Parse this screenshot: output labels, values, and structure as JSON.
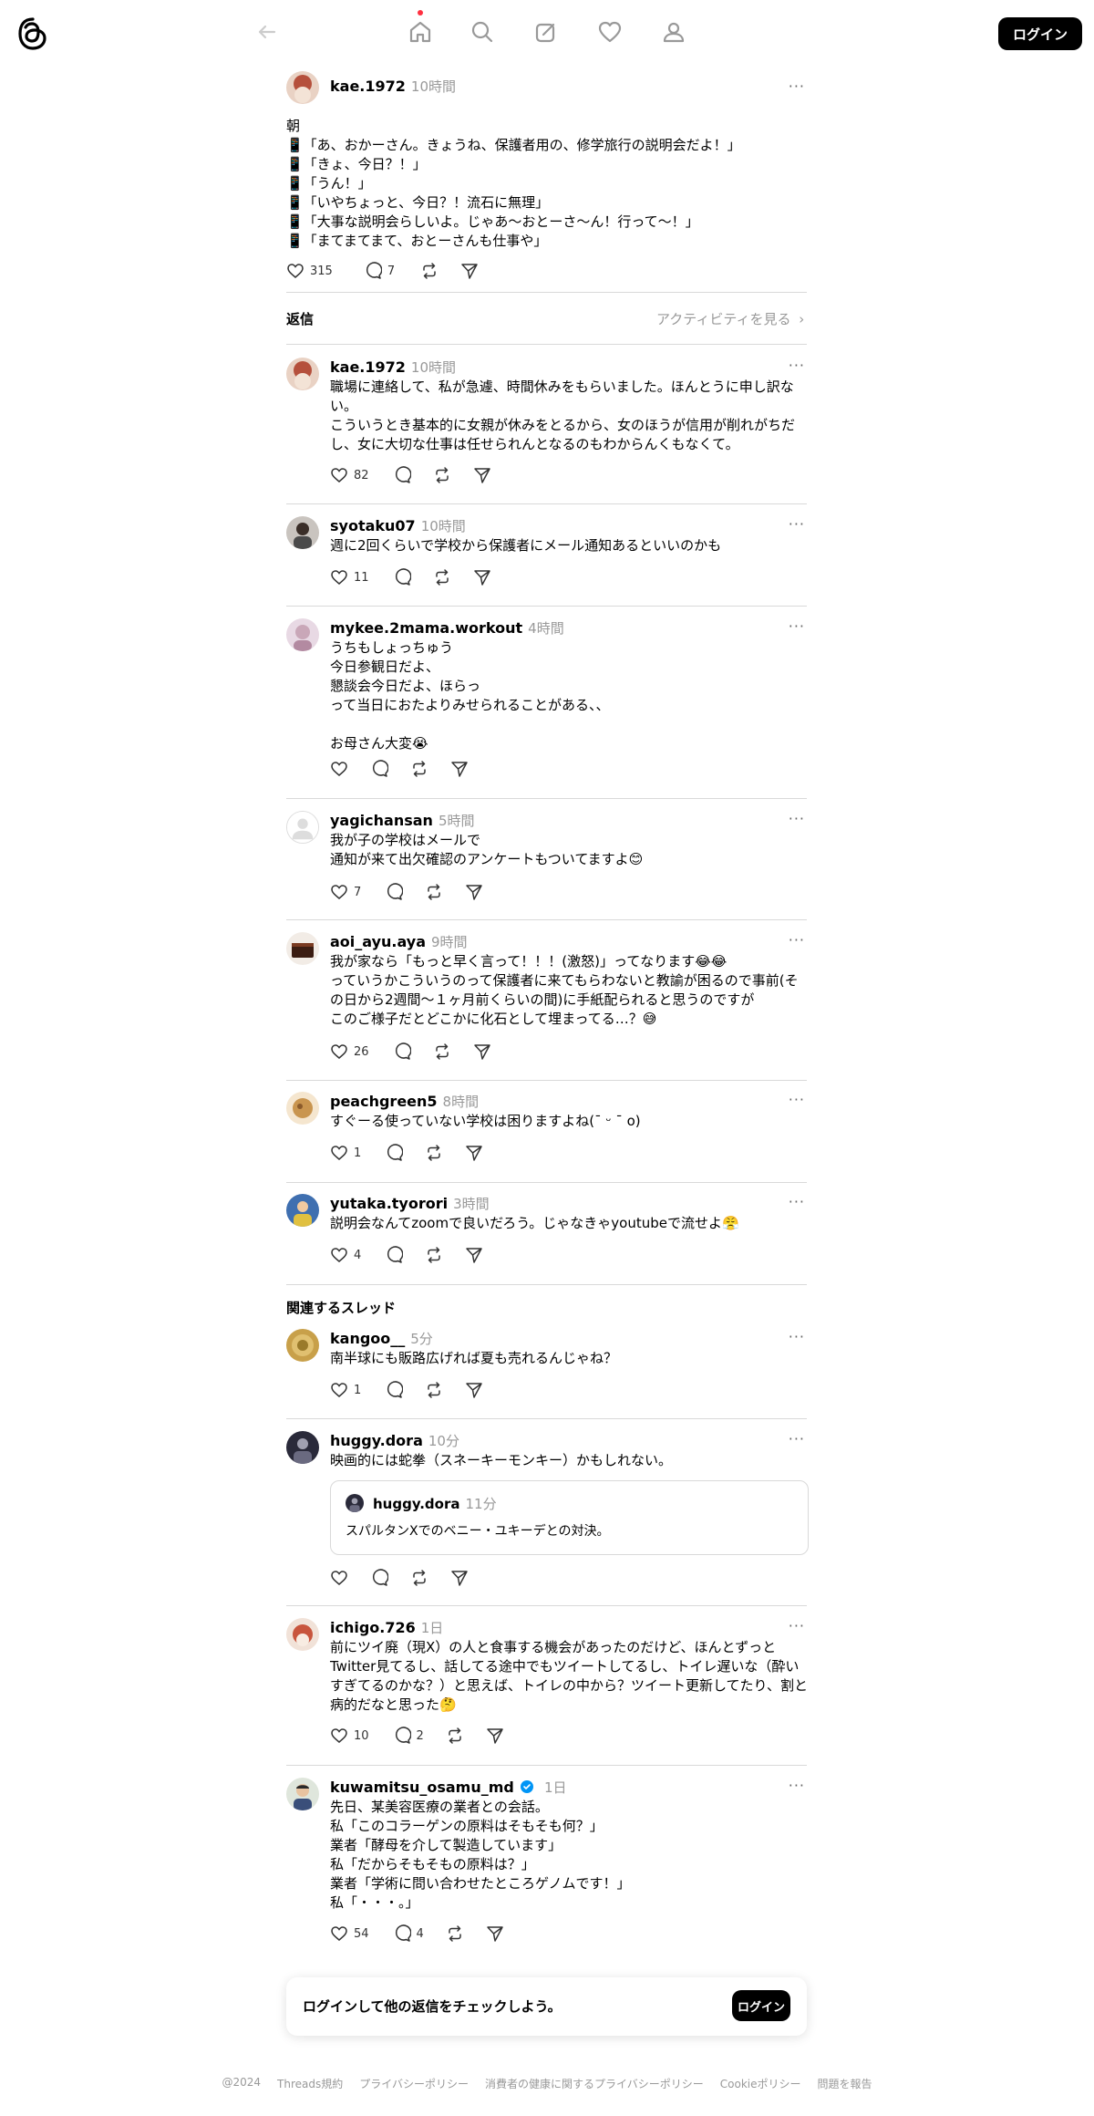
{
  "header": {
    "login_label": "ログイン"
  },
  "main_post": {
    "username": "kae.1972",
    "time": "10時間",
    "text": "朝\n📱「あ、おかーさん。きょうね、保護者用の、修学旅行の説明会だよ！」\n📱「きょ、今日？！」\n📱「うん！」\n📱「いやちょっと、今日？！流石に無理」\n📱「大事な説明会らしいよ。じゃあ〜おとーさ〜ん！行って〜！」\n📱「まてまてまて、おとーさんも仕事や」",
    "likes": "315",
    "replies": "7"
  },
  "replies_header": {
    "label": "返信",
    "activity_label": "アクティビティを見る"
  },
  "replies": [
    {
      "username": "kae.1972",
      "time": "10時間",
      "text": "職場に連絡して、私が急遽、時間休みをもらいました。ほんとうに申し訳ない。\nこういうとき基本的に女親が休みをとるから、女のほうが信用が削れがちだし、女に大切な仕事は任せられんとなるのもわからんくもなくて。",
      "likes": "82",
      "comments": ""
    },
    {
      "username": "syotaku07",
      "time": "10時間",
      "text": "週に2回くらいで学校から保護者にメール通知あるといいのかも",
      "likes": "11",
      "comments": ""
    },
    {
      "username": "mykee.2mama.workout",
      "time": "4時間",
      "text": "うちもしょっちゅう\n今日参観日だよ、\n懇談会今日だよ、ほらっ\nって当日におたよりみせられることがある、、\n\nお母さん大変😭",
      "likes": "",
      "comments": ""
    },
    {
      "username": "yagichansan",
      "time": "5時間",
      "text": "我が子の学校はメールで\n通知が来て出欠確認のアンケートもついてますよ😊",
      "likes": "7",
      "comments": ""
    },
    {
      "username": "aoi_ayu.aya",
      "time": "9時間",
      "text": "我が家なら「もっと早く言って！！！(激怒)」ってなります😂😂\nっていうかこういうのって保護者に来てもらわないと教諭が困るので事前(その日から2週間〜１ヶ月前くらいの間)に手紙配られると思うのですが\nこのご様子だとどこかに化石として埋まってる…？😅",
      "likes": "26",
      "comments": ""
    },
    {
      "username": "peachgreen5",
      "time": "8時間",
      "text": "すぐーる使っていない学校は困りますよね(ˉ ᵕ ˉ o)",
      "likes": "1",
      "comments": ""
    },
    {
      "username": "yutaka.tyorori",
      "time": "3時間",
      "text": "説明会なんてzoomで良いだろう。じゃなきゃyoutubeで流せよ😤",
      "likes": "4",
      "comments": ""
    }
  ],
  "related_header": {
    "label": "関連するスレッド"
  },
  "related": [
    {
      "username": "kangoo__",
      "time": "5分",
      "text": "南半球にも販路広げれば夏も売れるんじゃね？",
      "likes": "1",
      "comments": ""
    },
    {
      "username": "huggy.dora",
      "time": "10分",
      "text": "映画的には蛇拳（スネーキーモンキー）かもしれない。",
      "likes": "",
      "comments": "",
      "quote": {
        "username": "huggy.dora",
        "time": "11分",
        "text": "スパルタンXでのベニー・ユキーデとの対決。"
      }
    },
    {
      "username": "ichigo.726",
      "time": "1日",
      "text": "前にツイ廃（現X）の人と食事する機会があったのだけど、ほんとずっとTwitter見てるし、話してる途中でもツイートしてるし、トイレ遅いな（酔いすぎてるのかな？）と思えば、トイレの中から？ツイート更新してたり、割と病的だなと思った🤔",
      "likes": "10",
      "comments": "2"
    },
    {
      "username": "kuwamitsu_osamu_md",
      "time": "1日",
      "text": "先日、某美容医療の業者との会話。\n私「このコラーゲンの原料はそもそも何？」\n業者「酵母を介して製造しています」\n私「だからそもそもの原料は？」\n業者「学術に問い合わせたところゲノムです！」\n私「・・・。」",
      "likes": "54",
      "comments": "4"
    }
  ],
  "login_prompt": {
    "text": "ログインして他の返信をチェックしよう。",
    "button": "ログイン"
  },
  "footer": {
    "copyright": "@2024",
    "terms": "Threads規約",
    "privacy": "プライバシーポリシー",
    "health_privacy": "消費者の健康に関するプライバシーポリシー",
    "cookie": "Cookieポリシー",
    "report": "問題を報告"
  },
  "colors": {
    "accent_dot": "#ff3040",
    "verified": "#0095f6",
    "muted": "#999999"
  },
  "icons": [
    "threads-logo-icon",
    "back-arrow-icon",
    "home-icon",
    "search-icon",
    "compose-icon",
    "heart-icon",
    "profile-icon",
    "like-icon",
    "comment-icon",
    "repost-icon",
    "share-icon",
    "more-icon",
    "verified-badge-icon",
    "chevron-right-icon"
  ]
}
